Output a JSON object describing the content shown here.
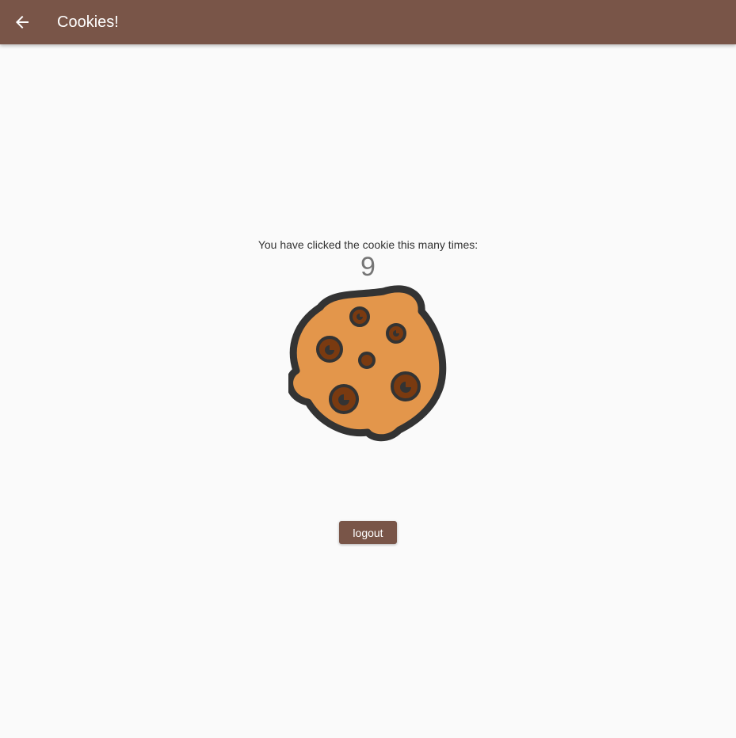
{
  "app_bar": {
    "title": "Cookies!",
    "back_icon": "arrow-back-icon",
    "color": "#795548"
  },
  "main": {
    "prompt": "You have clicked the cookie this many times:",
    "count": "9",
    "cookie_icon": "cookie-icon",
    "logout_label": "logout"
  },
  "colors": {
    "cookie_fill": "#e3964b",
    "cookie_outline": "#333333",
    "chip_fill": "#7a3a10",
    "background": "#fafafa"
  }
}
